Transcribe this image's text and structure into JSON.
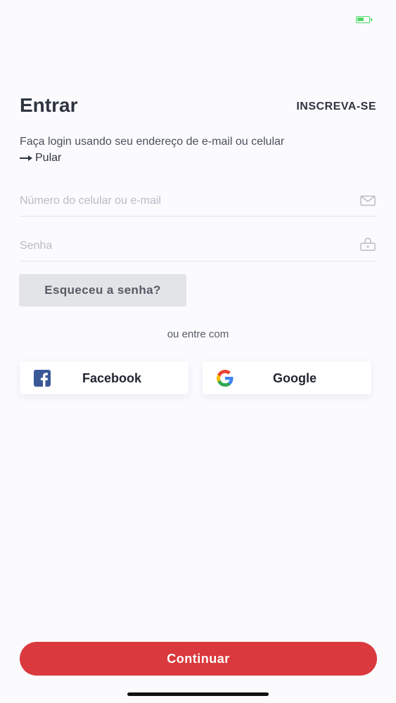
{
  "header": {
    "title": "Entrar",
    "signup_label": "INSCREVA-SE"
  },
  "intro": {
    "subtitle": "Faça login usando seu endereço de e-mail ou celular",
    "skip_label": "Pular"
  },
  "form": {
    "identifier": {
      "value": "",
      "placeholder": "Número do celular ou e-mail",
      "icon": "envelope-icon"
    },
    "password": {
      "value": "",
      "placeholder": "Senha",
      "icon": "lock-icon"
    },
    "forgot_label": "Esqueceu a senha?"
  },
  "social": {
    "divider_text": "ou entre com",
    "facebook_label": "Facebook",
    "google_label": "Google"
  },
  "footer": {
    "continue_label": "Continuar"
  },
  "colors": {
    "primary": "#da3a3d",
    "facebook": "#3b5998",
    "battery": "#4cd964"
  }
}
